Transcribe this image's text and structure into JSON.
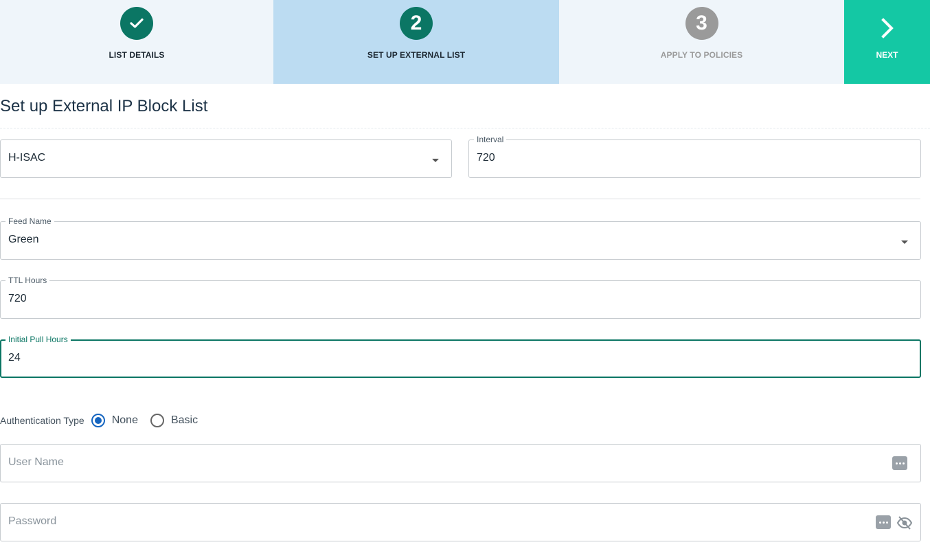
{
  "stepper": {
    "steps": [
      {
        "number": "✓",
        "label": "LIST DETAILS"
      },
      {
        "number": "2",
        "label": "SET UP EXTERNAL LIST"
      },
      {
        "number": "3",
        "label": "APPLY TO POLICIES"
      }
    ],
    "next_label": "NEXT"
  },
  "page_title": "Set up External IP Block List",
  "form": {
    "source_value": "H-ISAC",
    "interval_label": "Interval",
    "interval_value": "720",
    "feed_name_label": "Feed Name",
    "feed_name_value": "Green",
    "ttl_label": "TTL Hours",
    "ttl_value": "720",
    "initial_pull_label": "Initial Pull Hours",
    "initial_pull_value": "24",
    "auth_label": "Authentication Type",
    "auth_options": [
      "None",
      "Basic"
    ],
    "auth_selected": "None",
    "username_placeholder": "User Name",
    "password_placeholder": "Password"
  },
  "colors": {
    "accent": "#0b7664",
    "next_button": "#14c8a4",
    "active_step_bg": "#bcdcf2",
    "radio_selected": "#1565c0"
  }
}
